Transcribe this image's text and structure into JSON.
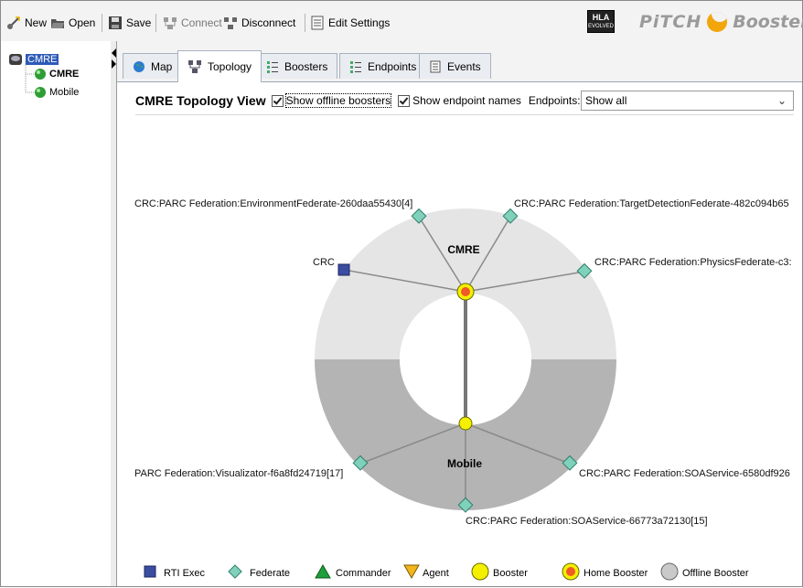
{
  "toolbar": {
    "new_label": "New",
    "open_label": "Open",
    "save_label": "Save",
    "connect_label": "Connect",
    "disconnect_label": "Disconnect",
    "edit_settings_label": "Edit Settings",
    "hla_badge": "HLA",
    "hla_badge_sub": "EVOLVED",
    "brand_logo": "PiTCH Booster™"
  },
  "tree": {
    "root": "CMRE",
    "children": [
      "CMRE",
      "Mobile"
    ]
  },
  "tabs": [
    {
      "label": "Map",
      "icon": "globe-icon",
      "active": false
    },
    {
      "label": "Topology",
      "icon": "topology-icon",
      "active": true
    },
    {
      "label": "Boosters",
      "icon": "list-icon",
      "active": false
    },
    {
      "label": "Endpoints",
      "icon": "list-icon",
      "active": false
    },
    {
      "label": "Events",
      "icon": "document-icon",
      "active": false
    }
  ],
  "view": {
    "title": "CMRE Topology View",
    "show_offline_label": "Show offline boosters",
    "show_offline_checked": true,
    "show_names_label": "Show endpoint names",
    "show_names_checked": true,
    "endpoints_label": "Endpoints:",
    "endpoints_value": "Show all"
  },
  "topology": {
    "cmre_label": "CMRE",
    "mobile_label": "Mobile",
    "endpoints": [
      "CRC:PARC Federation:EnvironmentFederate-260daa55430[4]",
      "CRC:PARC Federation:TargetDetectionFederate-482c094b65",
      "CRC",
      "CRC:PARC Federation:PhysicsFederate-c3:",
      "PARC Federation:Visualizator-f6a8fd24719[17]",
      "CRC:PARC Federation:SOAService-6580df926",
      "CRC:PARC Federation:SOAService-66773a72130[15]"
    ]
  },
  "legend": {
    "rti_exec": "RTI Exec",
    "federate": "Federate",
    "commander": "Commander",
    "agent": "Agent",
    "booster": "Booster",
    "home_booster": "Home Booster",
    "offline_booster": "Offline Booster"
  },
  "colors": {
    "home_booster": "#f05a28",
    "booster": "#f4f000",
    "federate": "#7fd1bc",
    "rti_exec": "#3a4da0",
    "commander": "#1f9e3a",
    "agent": "#f2b51c"
  }
}
